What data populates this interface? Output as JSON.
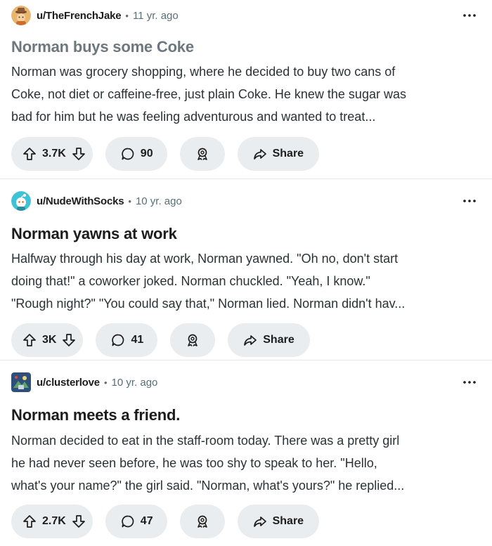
{
  "colors": {
    "pill_bg": "#eaedef",
    "text": "#1c1c1c",
    "meta_text": "#576f76",
    "visited_title": "#6c787d"
  },
  "posts": [
    {
      "author": "u/TheFrenchJake",
      "separator": "•",
      "age": "11 yr. ago",
      "title": "Norman buys some Coke",
      "title_visited": true,
      "body_lines": [
        "Norman was grocery shopping, where he decided to buy two cans of",
        "Coke, not diet or caffeine-free, just plain Coke. He knew the sugar was",
        "bad for him but he was feeling adventurous and wanted to treat..."
      ],
      "votes": "3.7K",
      "comments": "90",
      "share_label": "Share",
      "avatar_icon": "snoo-avatar-orange-hat",
      "more_icon": "more-options-icon"
    },
    {
      "author": "u/NudeWithSocks",
      "separator": "•",
      "age": "10 yr. ago",
      "title": "Norman yawns at work",
      "title_visited": false,
      "body_lines": [
        "Halfway through his day at work, Norman yawned. \"Oh no, don't start",
        "doing that!\" a coworker joked. Norman chuckled. \"Yeah, I know.\"",
        "\"Rough night?\" \"You could say that,\" Norman lied. Norman didn't hav..."
      ],
      "votes": "3K",
      "comments": "41",
      "share_label": "Share",
      "avatar_icon": "snoo-avatar-teal",
      "more_icon": "more-options-icon"
    },
    {
      "author": "u/clusterlove",
      "separator": "•",
      "age": "10 yr. ago",
      "title": "Norman meets a friend.",
      "title_visited": false,
      "body_lines": [
        "Norman decided to eat in the staff-room today. There was a pretty girl",
        "he had never seen before, he was too shy to speak to her. \"Hello,",
        "what's your name?\" the girl said. \"Norman, what's yours?\" he replied..."
      ],
      "votes": "2.7K",
      "comments": "47",
      "share_label": "Share",
      "avatar_icon": "avatar-image",
      "more_icon": "more-options-icon"
    }
  ]
}
